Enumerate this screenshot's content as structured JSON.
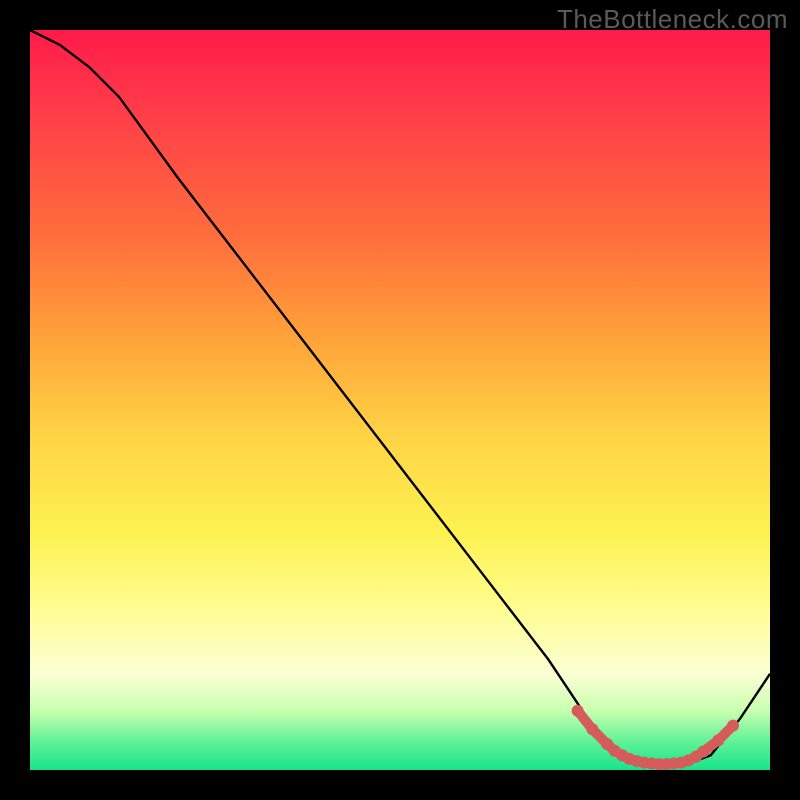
{
  "watermark": "TheBottleneck.com",
  "chart_data": {
    "type": "line",
    "title": "",
    "xlabel": "",
    "ylabel": "",
    "xlim": [
      0,
      100
    ],
    "ylim": [
      0,
      100
    ],
    "series": [
      {
        "name": "curve",
        "x": [
          0,
          4,
          8,
          12,
          20,
          30,
          40,
          50,
          60,
          70,
          76,
          80,
          84,
          88,
          92,
          96,
          100
        ],
        "y": [
          100,
          98,
          95,
          91,
          80,
          67,
          54,
          41,
          28,
          15,
          6,
          2,
          0.5,
          0.5,
          2,
          7,
          13
        ]
      }
    ],
    "markers": {
      "name": "beads",
      "x": [
        74,
        76,
        78,
        79,
        80,
        81,
        82,
        83,
        84,
        85,
        86,
        87,
        88,
        89,
        90,
        91,
        93,
        95
      ],
      "y": [
        8,
        5.5,
        3.5,
        2.6,
        2,
        1.5,
        1.2,
        1,
        0.9,
        0.8,
        0.8,
        0.9,
        1,
        1.3,
        1.8,
        2.5,
        4,
        6
      ]
    },
    "gradient_stops": [
      {
        "pos": 0,
        "color": "#ff1a4a"
      },
      {
        "pos": 10,
        "color": "#ff3a49"
      },
      {
        "pos": 28,
        "color": "#ff6e3c"
      },
      {
        "pos": 42,
        "color": "#ffa43a"
      },
      {
        "pos": 55,
        "color": "#ffd445"
      },
      {
        "pos": 68,
        "color": "#fdf251"
      },
      {
        "pos": 78,
        "color": "#fffd8f"
      },
      {
        "pos": 87,
        "color": "#fbffd5"
      },
      {
        "pos": 92,
        "color": "#c8ffb0"
      },
      {
        "pos": 96,
        "color": "#63f297"
      },
      {
        "pos": 100,
        "color": "#18e48b"
      }
    ]
  }
}
